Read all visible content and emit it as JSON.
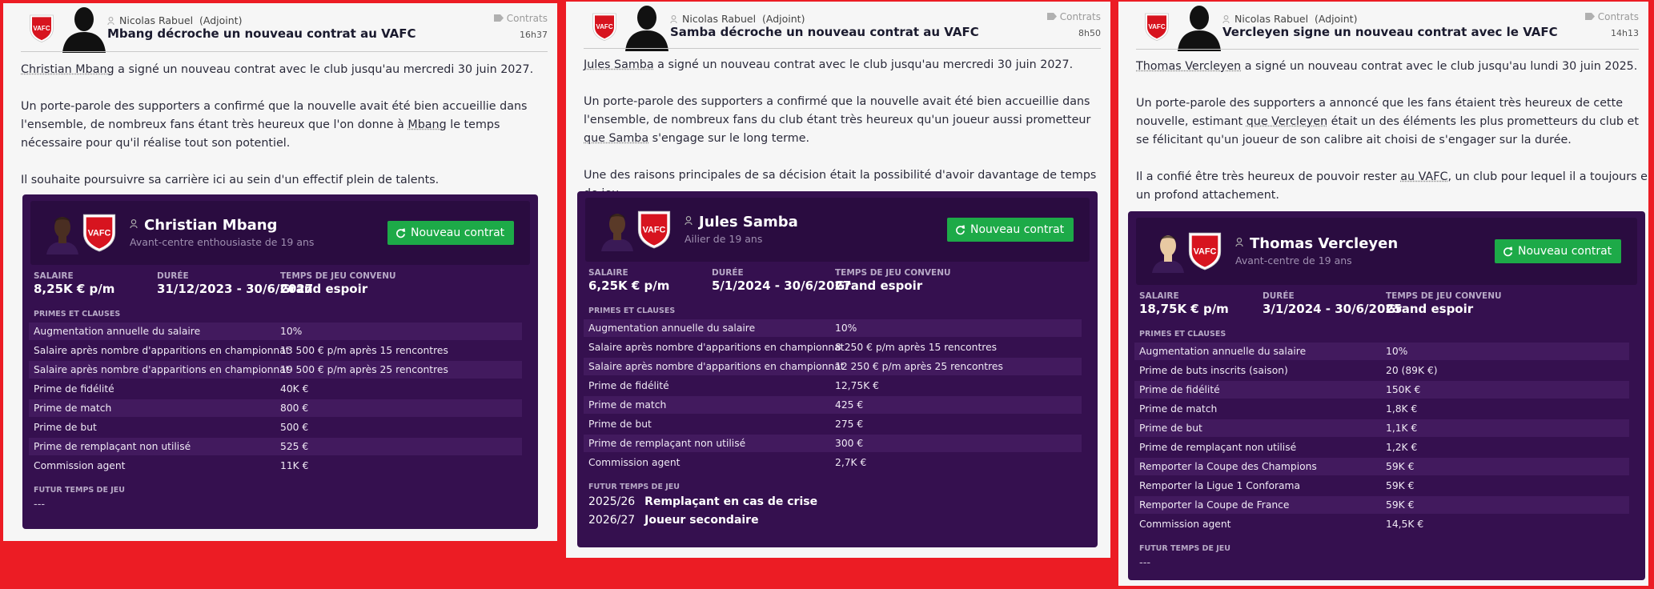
{
  "colors": {
    "background": "#ec1c24",
    "card": "#35104f",
    "button": "#1daa48"
  },
  "crest_text": "VAFC",
  "articles": [
    {
      "author": "Nicolas Rabuel",
      "role": "(Adjoint)",
      "title": "Mbang décroche un nouveau contrat au VAFC",
      "category": "Contrats",
      "time": "16h37",
      "paragraphs": [
        {
          "pre": "",
          "link": "Christian Mbang",
          "post": " a signé un nouveau contrat avec le club jusqu'au mercredi 30 juin 2027."
        },
        {
          "pre": "Un porte-parole des supporters a confirmé que la nouvelle avait été bien accueillie dans l'ensemble, de nombreux fans étant très heureux que l'on donne à ",
          "link": "Mbang",
          "post": " le temps nécessaire pour qu'il réalise tout son potentiel."
        },
        {
          "pre": "Il souhaite poursuivre sa carrière ici au sein d'un effectif plein de talents.",
          "link": "",
          "post": ""
        }
      ],
      "player": {
        "name": "Christian Mbang",
        "desc": "Avant-centre enthousiaste de 19 ans",
        "skin": "#4a2e22"
      },
      "button": "Nouveau contrat",
      "labels": {
        "salary": "SALAIRE",
        "duration": "DURÉE",
        "playtime": "TEMPS DE JEU CONVENU",
        "bonuses": "PRIMES ET CLAUSES",
        "future": "FUTUR TEMPS DE JEU"
      },
      "salary": "8,25K € p/m",
      "duration": "31/12/2023 - 30/6/2027",
      "playtime": "Grand espoir",
      "clauses": [
        [
          "Augmentation annuelle du salaire",
          "10%"
        ],
        [
          "Salaire après nombre d'apparitions en championnat",
          "13 500 € p/m après 15 rencontres"
        ],
        [
          "Salaire après nombre d'apparitions en championnat",
          "19 500 € p/m après 25 rencontres"
        ],
        [
          "Prime de fidélité",
          "40K €"
        ],
        [
          "Prime de match",
          "800 €"
        ],
        [
          "Prime de but",
          "500 €"
        ],
        [
          "Prime de remplaçant non utilisé",
          "525 €"
        ],
        [
          "Commission agent",
          "11K €"
        ]
      ],
      "future": [],
      "future_empty": "---"
    },
    {
      "author": "Nicolas Rabuel",
      "role": "(Adjoint)",
      "title": "Samba décroche un nouveau contrat au VAFC",
      "category": "Contrats",
      "time": "8h50",
      "paragraphs": [
        {
          "pre": "",
          "link": "Jules Samba",
          "post": " a signé un nouveau contrat avec le club jusqu'au mercredi 30 juin 2027."
        },
        {
          "pre": "Un porte-parole des supporters a confirmé que la nouvelle avait été bien accueillie dans l'ensemble, de nombreux fans du club étant très heureux qu'un joueur aussi prometteur ",
          "link": "que Samba",
          "post": " s'engage sur le long terme."
        },
        {
          "pre": "Une des raisons principales de sa décision était la possibilité d'avoir davantage de temps de jeu.",
          "link": "",
          "post": ""
        }
      ],
      "player": {
        "name": "Jules Samba",
        "desc": "Ailier de 19 ans",
        "skin": "#5a3a28"
      },
      "button": "Nouveau contrat",
      "labels": {
        "salary": "SALAIRE",
        "duration": "DURÉE",
        "playtime": "TEMPS DE JEU CONVENU",
        "bonuses": "PRIMES ET CLAUSES",
        "future": "FUTUR TEMPS DE JEU"
      },
      "salary": "6,25K € p/m",
      "duration": "5/1/2024 - 30/6/2027",
      "playtime": "Grand espoir",
      "clauses": [
        [
          "Augmentation annuelle du salaire",
          "10%"
        ],
        [
          "Salaire après nombre d'apparitions en championnat",
          "8 250 € p/m après 15 rencontres"
        ],
        [
          "Salaire après nombre d'apparitions en championnat",
          "12 250 € p/m après 25 rencontres"
        ],
        [
          "Prime de fidélité",
          "12,75K €"
        ],
        [
          "Prime de match",
          "425 €"
        ],
        [
          "Prime de but",
          "275 €"
        ],
        [
          "Prime de remplaçant non utilisé",
          "300 €"
        ],
        [
          "Commission agent",
          "2,7K €"
        ]
      ],
      "future": [
        {
          "season": "2025/26",
          "role": "Remplaçant en cas de crise"
        },
        {
          "season": "2026/27",
          "role": "Joueur secondaire"
        }
      ],
      "future_empty": ""
    },
    {
      "author": "Nicolas Rabuel",
      "role": "(Adjoint)",
      "title": "Vercleyen signe un nouveau contrat avec le VAFC",
      "category": "Contrats",
      "time": "14h13",
      "paragraphs": [
        {
          "pre": "",
          "link": "Thomas Vercleyen",
          "post": " a signé un nouveau contrat avec le club jusqu'au lundi 30 juin 2025."
        },
        {
          "pre": "Un porte-parole des supporters a annoncé que les fans étaient très heureux de cette nouvelle, estimant ",
          "link": "que Vercleyen",
          "post": " était un des éléments les plus prometteurs du club et se félicitant qu'un joueur de son calibre ait choisi de s'engager sur la durée."
        },
        {
          "pre": "Il a confié être très heureux de pouvoir rester ",
          "link": "au VAFC",
          "post": ", un club pour lequel il a toujours eu un profond attachement."
        }
      ],
      "player": {
        "name": "Thomas Vercleyen",
        "desc": "Avant-centre de 19 ans",
        "skin": "#e8c9a2"
      },
      "button": "Nouveau contrat",
      "labels": {
        "salary": "SALAIRE",
        "duration": "DURÉE",
        "playtime": "TEMPS DE JEU CONVENU",
        "bonuses": "PRIMES ET CLAUSES",
        "future": "FUTUR TEMPS DE JEU"
      },
      "salary": "18,75K € p/m",
      "duration": "3/1/2024 - 30/6/2025",
      "playtime": "Grand espoir",
      "clauses": [
        [
          "Augmentation annuelle du salaire",
          "10%"
        ],
        [
          "Prime de buts inscrits (saison)",
          "20 (89K €)"
        ],
        [
          "Prime de fidélité",
          "150K €"
        ],
        [
          "Prime de match",
          "1,8K €"
        ],
        [
          "Prime de but",
          "1,1K €"
        ],
        [
          "Prime de remplaçant non utilisé",
          "1,2K €"
        ],
        [
          "Remporter la Coupe des Champions",
          "59K €"
        ],
        [
          "Remporter la Ligue 1 Conforama",
          "59K €"
        ],
        [
          "Remporter la Coupe de France",
          "59K €"
        ],
        [
          "Commission agent",
          "14,5K €"
        ]
      ],
      "future": [],
      "future_empty": "---"
    }
  ]
}
